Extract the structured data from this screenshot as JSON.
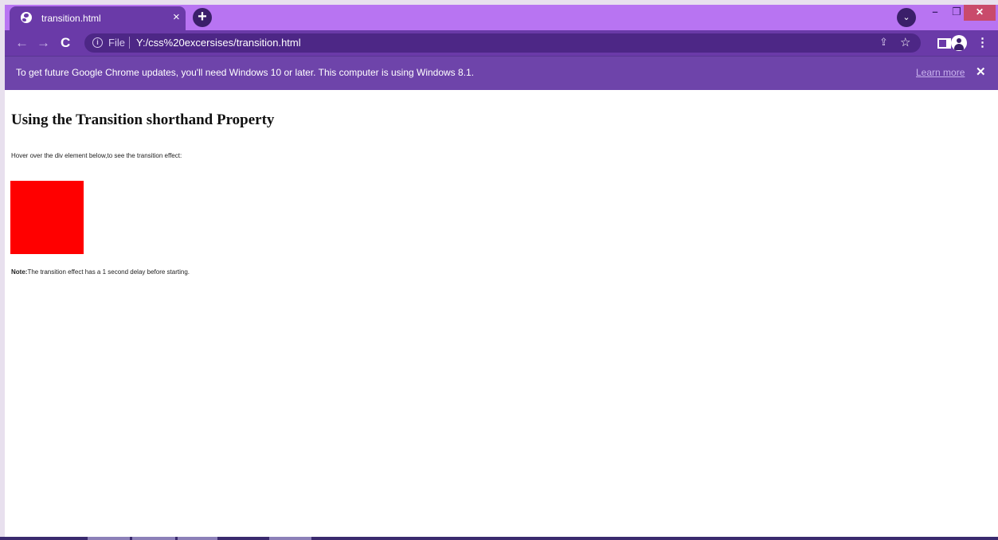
{
  "browser": {
    "tab": {
      "title": "transition.html",
      "close_glyph": "×",
      "icon": "globe-icon"
    },
    "new_tab_glyph": "+",
    "tab_search_glyph": "⌄",
    "window_controls": {
      "minimize": "–",
      "maximize": "❐",
      "close": "✕"
    },
    "toolbar": {
      "back_glyph": "←",
      "forward_glyph": "→",
      "reload_glyph": "C",
      "info_glyph": "i",
      "file_label": "File",
      "url": "Y:/css%20excersises/transition.html",
      "share_glyph": "⇪",
      "star_glyph": "☆",
      "menu_glyph": "⋮"
    },
    "infobar": {
      "message": "To get future Google Chrome updates, you'll need Windows 10 or later. This computer is using Windows 8.1.",
      "learn_more": "Learn more",
      "close_glyph": "✕"
    }
  },
  "page": {
    "title": "Using the Transition shorthand Property",
    "intro": "Hover over the div element below,to see the transition effect:",
    "box_color": "#ff0000",
    "note_label": "Note:",
    "note_text": "The transition effect has a 1 second delay before starting."
  },
  "colors": {
    "titlebar": "#b874f2",
    "toolbar": "#6a3aa8",
    "infobar": "#6e44aa",
    "close_button": "#c94a6b"
  }
}
